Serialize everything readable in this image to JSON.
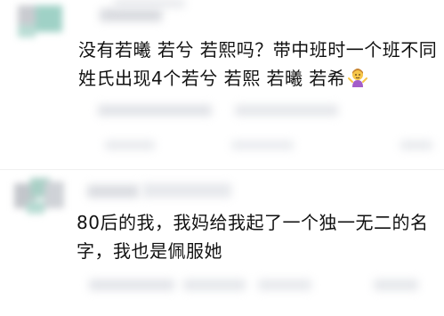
{
  "comments": [
    {
      "lines": [
        "没有若曦 若兮 若熙吗？带中班时一个班不同",
        "姓氏出现4个若兮 若熙 若曦 若希"
      ],
      "emoji": "woman-shrugging-emoji"
    },
    {
      "lines": [
        "80后的我，我妈给我起了一个独一无二的名",
        "字，我也是佩服她"
      ]
    }
  ],
  "colors": {
    "text": "#111111",
    "blur_gray": "#d9dbe0",
    "avatar_green": "#9fc9bf",
    "avatar_gray": "#c6c9ce"
  }
}
